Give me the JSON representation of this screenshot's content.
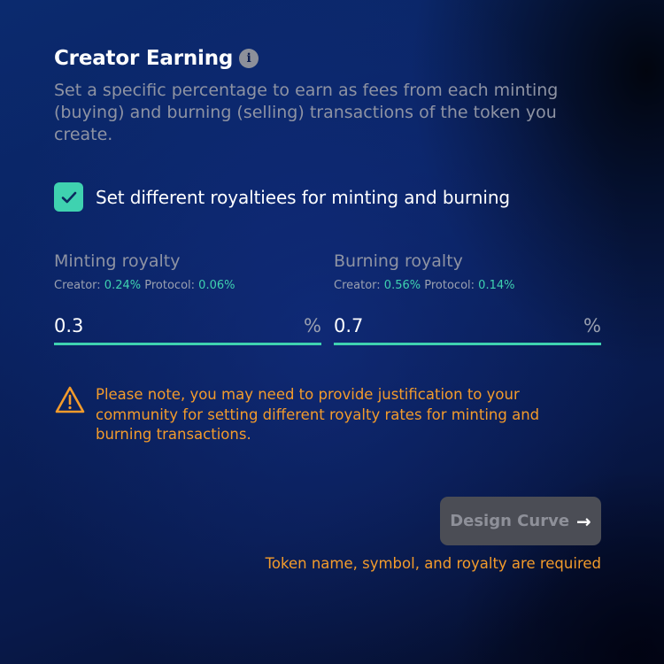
{
  "header": {
    "title": "Creator Earning",
    "info_icon": "i",
    "description": "Set a specific percentage to earn as fees from each minting (buying) and burning (selling) transactions of the token you create."
  },
  "checkbox": {
    "checked": true,
    "label": "Set different royaltiees for minting and burning"
  },
  "minting": {
    "title": "Minting royalty",
    "creator_label": "Creator:",
    "creator_value": "0.24%",
    "protocol_label": "Protocol:",
    "protocol_value": "0.06%",
    "input_value": "0.3",
    "unit": "%"
  },
  "burning": {
    "title": "Burning royalty",
    "creator_label": "Creator:",
    "creator_value": "0.56%",
    "protocol_label": "Protocol:",
    "protocol_value": "0.14%",
    "input_value": "0.7",
    "unit": "%"
  },
  "warning": {
    "icon": "warning-triangle-icon",
    "text": "Please note, you may need to provide justification to your community for setting different royalty rates for minting and burning transactions."
  },
  "actions": {
    "design_curve_label": "Design Curve",
    "design_curve_arrow": "→",
    "disabled": true,
    "required_note": "Token name, symbol, and royalty are required"
  },
  "colors": {
    "accent": "#3fd2b0",
    "warning": "#f39b2b",
    "muted_text": "#8e93a3",
    "button_disabled_bg": "#4b4d55"
  }
}
